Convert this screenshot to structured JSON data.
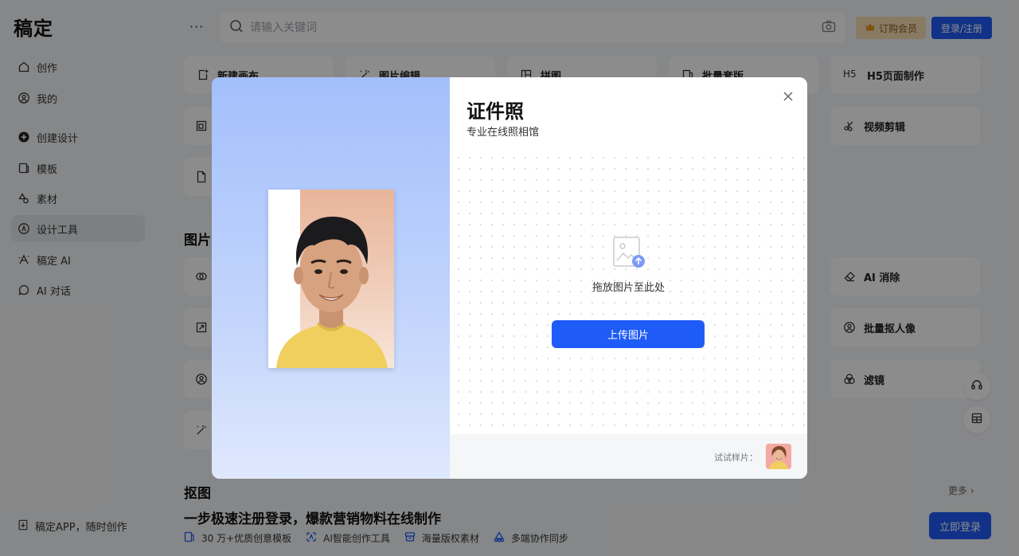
{
  "app": {
    "logo": "稿定"
  },
  "sidebar": {
    "items": [
      {
        "label": "创作",
        "icon": "home-icon"
      },
      {
        "label": "我的",
        "icon": "user-icon"
      },
      {
        "label": "创建设计",
        "icon": "plus-circle-icon"
      },
      {
        "label": "模板",
        "icon": "template-icon"
      },
      {
        "label": "素材",
        "icon": "shapes-icon"
      },
      {
        "label": "设计工具",
        "icon": "compass-icon",
        "active": true
      },
      {
        "label": "稿定 AI",
        "icon": "ai-icon"
      },
      {
        "label": "AI 对话",
        "icon": "chat-icon"
      }
    ],
    "footer": "稿定APP，随时创作"
  },
  "header": {
    "more": "···",
    "search_placeholder": "请输入关键词",
    "vip_label": "订购会员",
    "login_label": "登录/注册"
  },
  "tools": {
    "row1": [
      "新建画布",
      "图片编辑",
      "拼图",
      "批量套版",
      "H5页面制作"
    ],
    "row2_right": "视频剪辑",
    "section_title": "图片",
    "right_column": [
      "AI 消除",
      "批量抠人像",
      "滤镜"
    ]
  },
  "section2": {
    "title": "抠图",
    "more": "更多 ›"
  },
  "promo": {
    "title": "一步极速注册登录，爆款营销物料在线制作",
    "features": [
      "30 万+优质创意模板",
      "AI智能创作工具",
      "海量版权素材",
      "多端协作同步"
    ],
    "button": "立即登录"
  },
  "modal": {
    "title": "证件照",
    "subtitle": "专业在线照相馆",
    "drop_text": "拖放图片至此处",
    "upload_button": "上传图片",
    "sample_label": "试试样片："
  },
  "colors": {
    "brand": "#1f5bf7",
    "vip_bg": "#f9dfb4",
    "overlay": "rgba(0,0,0,0.45)"
  }
}
